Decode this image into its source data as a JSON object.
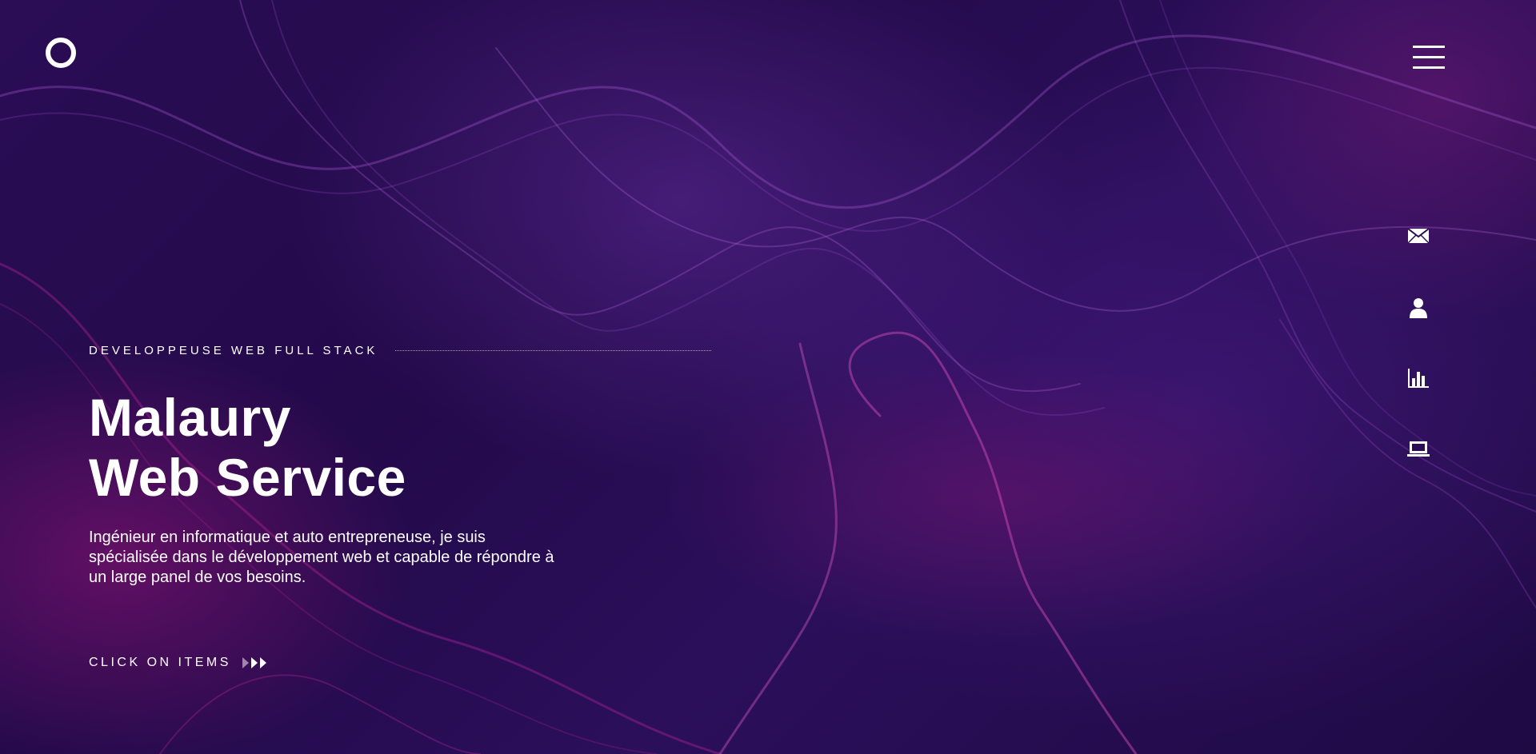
{
  "header": {
    "logo_icon": "circle-logo",
    "menu_icon": "hamburger-icon"
  },
  "side_nav": [
    {
      "icon": "envelope-icon"
    },
    {
      "icon": "user-icon"
    },
    {
      "icon": "bar-chart-icon"
    },
    {
      "icon": "laptop-icon"
    }
  ],
  "hero": {
    "eyebrow": "DEVELOPPEUSE WEB FULL STACK",
    "title_line1": "Malaury",
    "title_line2": "Web Service",
    "description": "Ingénieur en informatique et auto entrepreneuse, je suis spécialisée dans le développement web et capable de répondre à un large panel de vos besoins.",
    "cta_label": "CLICK ON ITEMS",
    "cta_icon": "triple-chevron-icon"
  },
  "colors": {
    "background": "#2a0d55",
    "accent_magenta": "#a0208a",
    "text": "#ffffff"
  }
}
